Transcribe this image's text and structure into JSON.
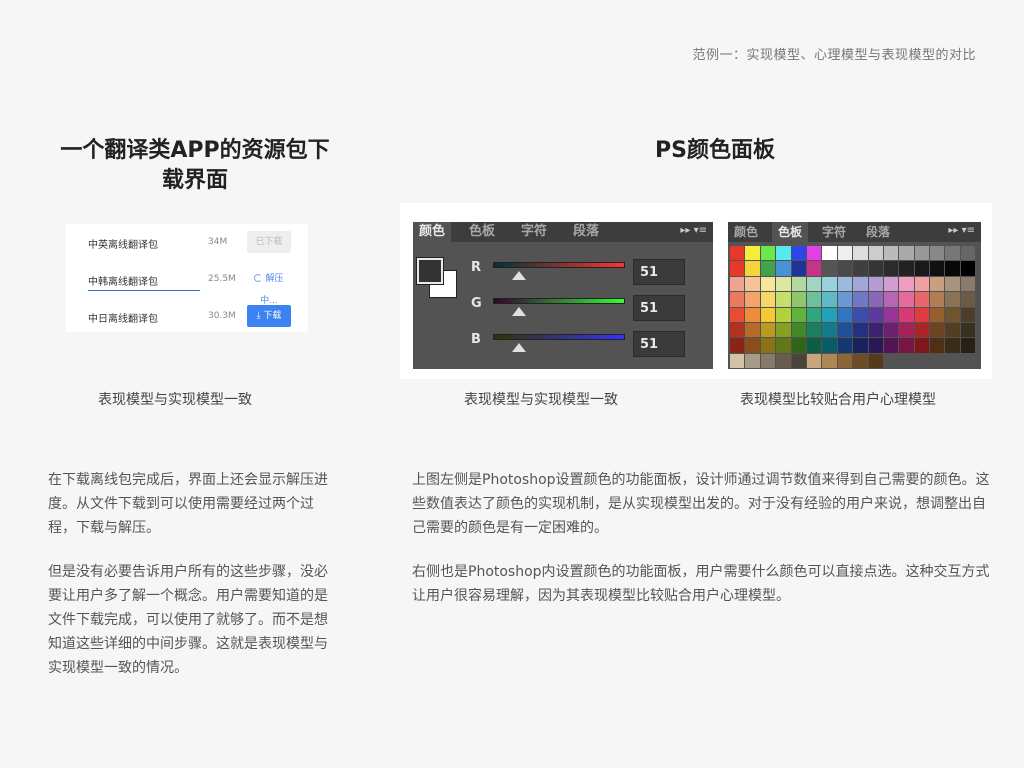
{
  "header": {
    "caption": "范例一：实现模型、心理模型与表现模型的对比"
  },
  "left_column": {
    "title": "一个翻译类APP的资源包下载界面",
    "download_list": [
      {
        "name": "中英离线翻译包",
        "size": "34M",
        "action": "已下载",
        "state": "done"
      },
      {
        "name": "中韩离线翻译包",
        "size": "25.5M",
        "action": "解压中...",
        "state": "extracting"
      },
      {
        "name": "中日离线翻译包",
        "size": "30.3M",
        "action": "下载",
        "state": "download"
      }
    ],
    "caption": "表现模型与实现模型一致",
    "paragraphs": [
      "在下载离线包完成后，界面上还会显示解压进度。从文件下载到可以使用需要经过两个过程，下载与解压。",
      "但是没有必要告诉用户所有的这些步骤，没必要让用户多了解一个概念。用户需要知道的是文件下载完成，可以使用了就够了。而不是想知道这些详细的中间步骤。这就是表现模型与实现模型一致的情况。"
    ]
  },
  "right_column": {
    "title": "PS颜色面板",
    "color_panel": {
      "tabs": [
        "颜色",
        "色板",
        "字符",
        "段落"
      ],
      "channels": [
        {
          "label": "R",
          "value": "51",
          "gradient": [
            "#003333",
            "#ff3333"
          ]
        },
        {
          "label": "G",
          "value": "51",
          "gradient": [
            "#330033",
            "#33ff33"
          ]
        },
        {
          "label": "B",
          "value": "51",
          "gradient": [
            "#333300",
            "#3333ff"
          ]
        }
      ],
      "foreground_color": "#333333",
      "background_color": "#ffffff"
    },
    "swatch_panel": {
      "tabs": [
        "颜色",
        "色板",
        "字符",
        "段落"
      ]
    },
    "caption_left": "表现模型与实现模型一致",
    "caption_right": "表现模型比较贴合用户心理模型",
    "paragraphs": [
      "上图左侧是Photoshop设置颜色的功能面板，设计师通过调节数值来得到自己需要的颜色。这些数值表达了颜色的实现机制，是从实现模型出发的。对于没有经验的用户来说，想调整出自己需要的颜色是有一定困难的。",
      "右侧也是Photoshop内设置颜色的功能面板，用户需要什么颜色可以直接点选。这种交互方式让用户很容易理解，因为其表现模型比较贴合用户心理模型。"
    ]
  },
  "accent_color": "#3c82f0"
}
